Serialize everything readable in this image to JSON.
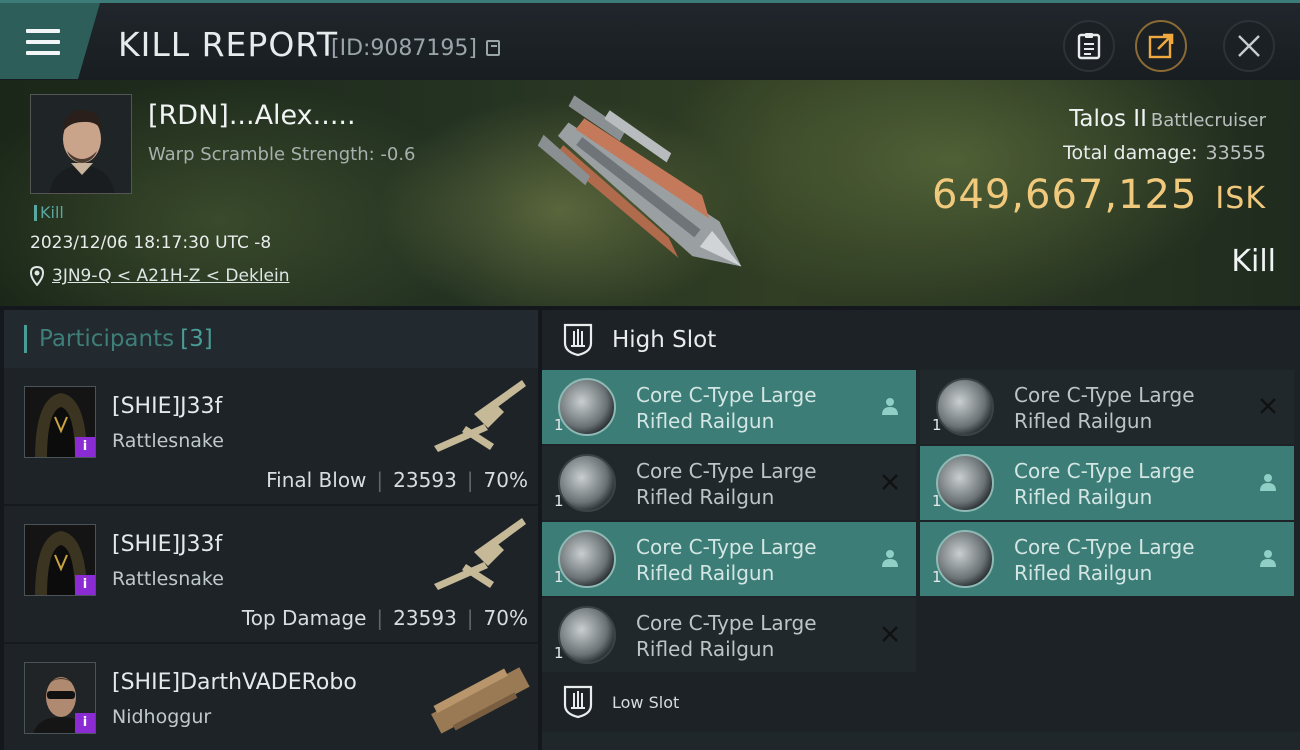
{
  "header": {
    "title": "KILL REPORT",
    "id_label": "[ID:9087195]"
  },
  "victim": {
    "name": "[RDN]...Alex.....",
    "warp_scramble": "Warp Scramble Strength: -0.6",
    "kill_tag": "Kill",
    "timestamp": "2023/12/06 18:17:30 UTC -8",
    "location": "3JN9-Q < A21H-Z < Deklein",
    "ship_name": "Talos II",
    "ship_class": "Battlecruiser",
    "total_damage_label": "Total damage:",
    "total_damage": "33555",
    "isk_value": "649,667,125",
    "isk_unit": "ISK",
    "result": "Kill"
  },
  "participants": {
    "title": "Participants",
    "count": "[3]",
    "items": [
      {
        "name": "[SHIE]J33f",
        "ship": "Rattlesnake",
        "role": "Final Blow",
        "damage": "23593",
        "percent": "70%"
      },
      {
        "name": "[SHIE]J33f",
        "ship": "Rattlesnake",
        "role": "Top Damage",
        "damage": "23593",
        "percent": "70%"
      },
      {
        "name": "[SHIE]DarthVADERobo",
        "ship": "Nidhoggur"
      }
    ]
  },
  "slots": {
    "high_title": "High Slot",
    "low_title": "Low Slot",
    "modules": [
      {
        "line1": "Core C-Type Large",
        "line2": "Rifled Railgun",
        "qty": "1",
        "status": "dropped"
      },
      {
        "line1": "Core C-Type Large",
        "line2": "Rifled Railgun",
        "qty": "1",
        "status": "destroyed"
      },
      {
        "line1": "Core C-Type Large",
        "line2": "Rifled Railgun",
        "qty": "1",
        "status": "destroyed"
      },
      {
        "line1": "Core C-Type Large",
        "line2": "Rifled Railgun",
        "qty": "1",
        "status": "dropped"
      },
      {
        "line1": "Core C-Type Large",
        "line2": "Rifled Railgun",
        "qty": "1",
        "status": "dropped"
      },
      {
        "line1": "Core C-Type Large",
        "line2": "Rifled Railgun",
        "qty": "1",
        "status": "dropped"
      },
      {
        "line1": "Core C-Type Large",
        "line2": "Rifled Railgun",
        "qty": "1",
        "status": "destroyed"
      }
    ]
  },
  "colors": {
    "accent": "#3c7d77",
    "isk": "#f1c97d",
    "corp_badge": "#8a2bd3"
  }
}
